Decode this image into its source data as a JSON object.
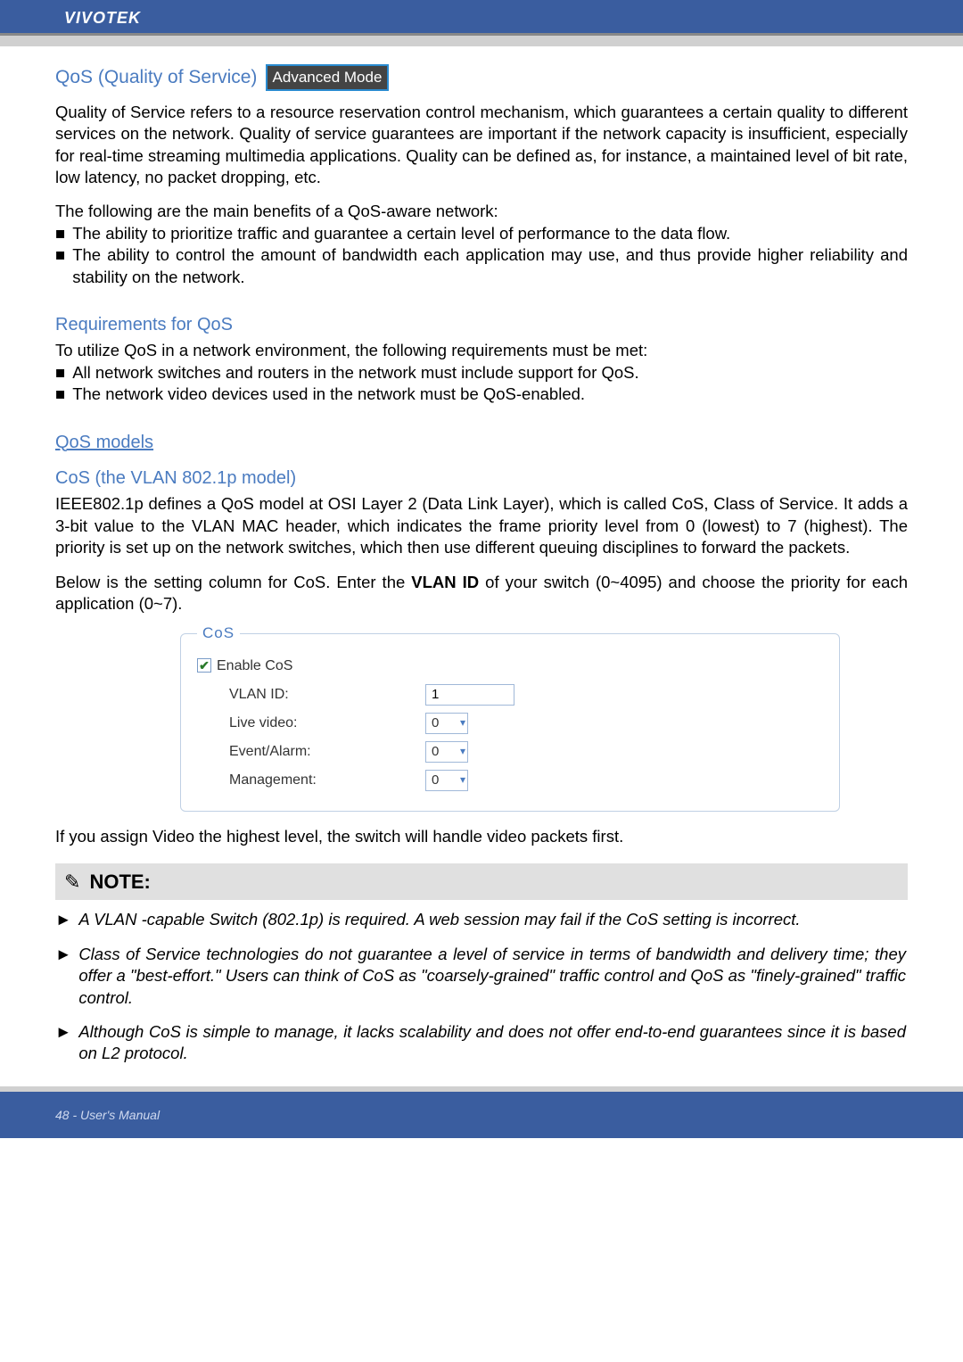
{
  "header": {
    "brand": "VIVOTEK"
  },
  "qos": {
    "title": "QoS (Quality of Service)",
    "advanced_label": "Advanced Mode",
    "intro": "Quality of Service refers to a resource reservation control mechanism, which guarantees a certain quality to different services on the network. Quality of service guarantees are important if the network capacity is insufficient, especially for real-time streaming multimedia applications. Quality can be defined as, for instance, a maintained level of bit rate, low latency, no packet dropping, etc.",
    "benefits_intro": "The following are the main benefits of a QoS-aware network:",
    "bullets": [
      "The ability to prioritize traffic and guarantee a certain level of performance to the data flow.",
      "The ability to control the amount of bandwidth each application may use, and thus provide higher reliability and stability on the network."
    ]
  },
  "req": {
    "title": "Requirements for QoS",
    "intro": "To utilize QoS in a network environment, the following requirements must be met:",
    "bullets": [
      "All network switches and routers in the network must include support for QoS.",
      "The network video devices used in the network must be QoS-enabled."
    ]
  },
  "models": {
    "title": "QoS models"
  },
  "cos": {
    "title": "CoS (the VLAN 802.1p model)",
    "para1_a": "IEEE802.1p defines a QoS model at OSI Layer 2 (Data Link Layer), which is called CoS, Class of Service. It adds a 3-bit value to the VLAN MAC header, which indicates the frame priority level from 0 (lowest) to 7 (highest). The priority is set up on the network switches, which then use different queuing disciplines to forward the packets.",
    "para2_a": "Below is the setting column for CoS. Enter the ",
    "para2_bold": "VLAN ID",
    "para2_b": " of your switch (0~4095) and choose the priority for each application (0~7).",
    "fieldset": {
      "legend": "CoS",
      "enable_label": "Enable CoS",
      "vlan_label": "VLAN ID:",
      "vlan_value": "1",
      "live_label": "Live video:",
      "live_value": "0",
      "event_label": "Event/Alarm:",
      "event_value": "0",
      "mgmt_label": "Management:",
      "mgmt_value": "0"
    },
    "after": "If you assign Video the highest level, the switch will handle video packets first."
  },
  "note": {
    "label": "NOTE:",
    "items": [
      "A VLAN -capable Switch (802.1p) is required. A web session may fail if the CoS setting is incorrect.",
      "Class of Service technologies do not guarantee a level of service in terms of bandwidth and delivery time; they offer a \"best-effort.\" Users can think of CoS as \"coarsely-grained\" traffic control and QoS as \"finely-grained\" traffic control.",
      "Although CoS is simple to manage, it lacks scalability and does not offer end-to-end guarantees since it is based on L2 protocol."
    ]
  },
  "footer": {
    "page": "48 - User's Manual"
  }
}
